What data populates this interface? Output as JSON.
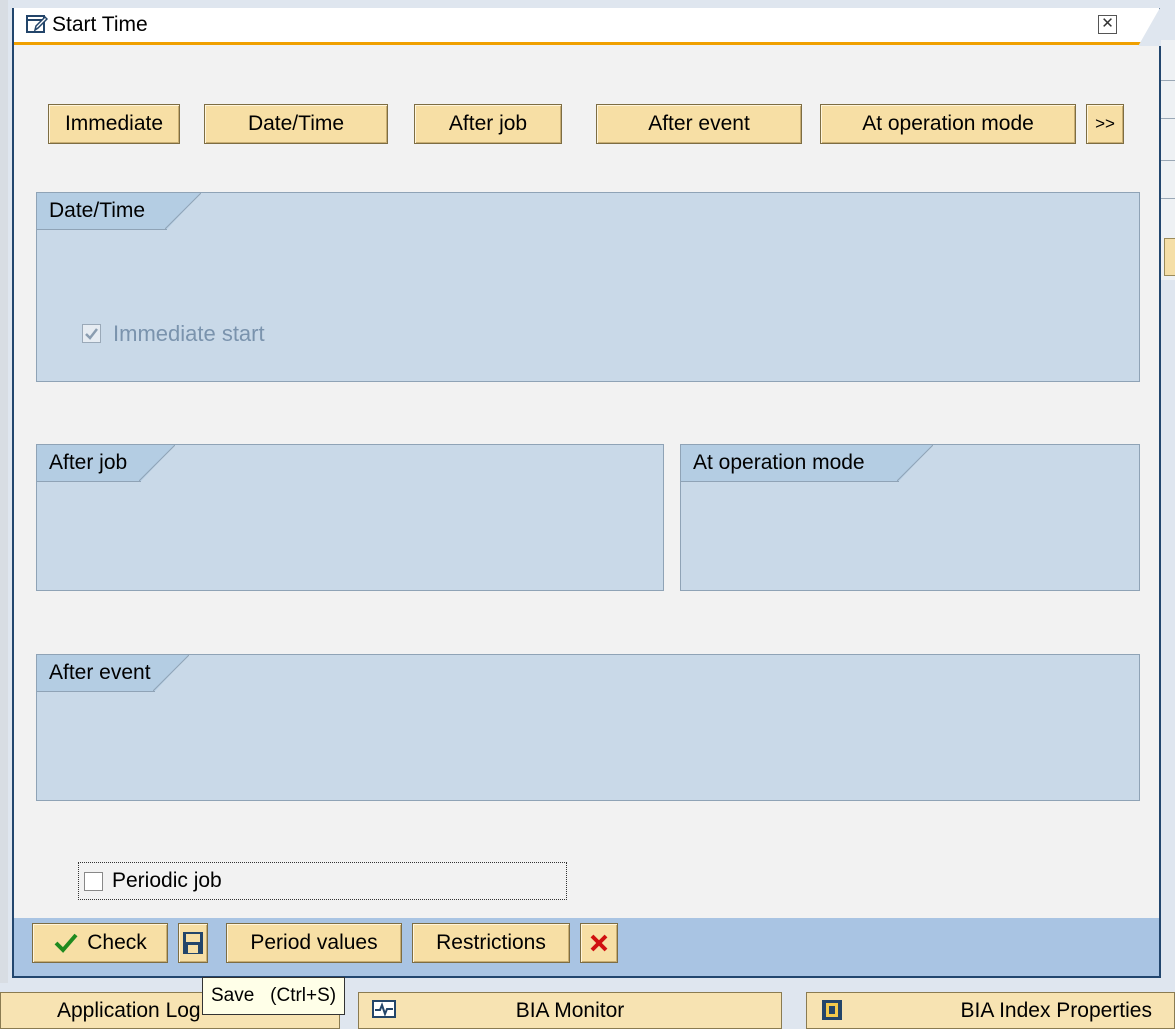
{
  "dialog": {
    "title": "Start Time",
    "close_icon": "close-icon"
  },
  "start_buttons": {
    "immediate": "Immediate",
    "date_time": "Date/Time",
    "after_job": "After job",
    "after_event": "After event",
    "at_operation_mode": "At operation mode",
    "more": ">>"
  },
  "groups": {
    "date_time": {
      "label": "Date/Time",
      "immediate_start": {
        "label": "Immediate start",
        "checked": true,
        "disabled": true
      }
    },
    "after_job": {
      "label": "After job"
    },
    "at_operation_mode": {
      "label": "At operation mode"
    },
    "after_event": {
      "label": "After event"
    }
  },
  "periodic": {
    "label": "Periodic job",
    "checked": false
  },
  "footer": {
    "check": "Check",
    "period_values": "Period values",
    "restrictions": "Restrictions"
  },
  "tooltip": {
    "text": "Save   (Ctrl+S)"
  },
  "background_buttons": {
    "application_log": "Application Log",
    "bia_monitor": "BIA Monitor",
    "bia_index_properties": "BIA Index Properties"
  },
  "colors": {
    "button_bg": "#f7dfa5",
    "group_bg": "#c9d9e8",
    "footer_bg": "#a9c4e3",
    "title_accent": "#f0a000"
  }
}
